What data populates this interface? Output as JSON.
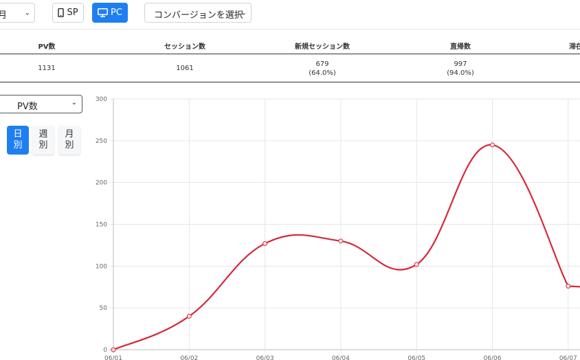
{
  "toolbar": {
    "period_value": "月",
    "sp_label": "SP",
    "pc_label": "PC",
    "conversion_placeholder": "コンバージョンを選択"
  },
  "summary_table": {
    "headers": [
      "PV数",
      "セッション数",
      "新規セッション数",
      "直帰数",
      "滞在"
    ],
    "row": {
      "pv": "1131",
      "sessions": "1061",
      "new_sessions": "679",
      "new_sessions_pct": "(64.0%)",
      "bounces": "997",
      "bounces_pct": "(94.0%)"
    }
  },
  "metric_select": {
    "value": "PV数"
  },
  "granularity": {
    "day": [
      "日",
      "別"
    ],
    "week": [
      "週",
      "別"
    ],
    "month": [
      "月",
      "別"
    ],
    "active": "day"
  },
  "colors": {
    "accent": "#1f7ff0",
    "line": "#d62839"
  },
  "chart_data": {
    "type": "line",
    "categories": [
      "06/01",
      "06/02",
      "06/03",
      "06/04",
      "06/05",
      "06/06",
      "06/07"
    ],
    "series": [
      {
        "values": [
          0,
          40,
          127,
          130,
          102,
          245,
          76
        ]
      }
    ],
    "ylim": [
      0,
      300
    ],
    "yticks": [
      0,
      50,
      100,
      150,
      200,
      250,
      300
    ],
    "grid": true
  }
}
